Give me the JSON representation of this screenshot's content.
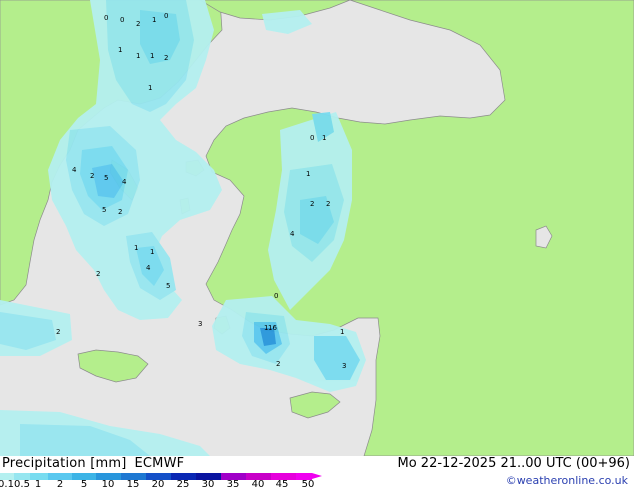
{
  "footer": {
    "title": "Precipitation [mm]",
    "model": "ECMWF",
    "datetime": "Mo 22-12-2025 21..00 UTC (00+96)",
    "credit": "©weatheronline.co.uk"
  },
  "legend": {
    "ticks": [
      "0.1",
      "0.5",
      "1",
      "2",
      "5",
      "10",
      "15",
      "20",
      "25",
      "30",
      "35",
      "40",
      "45",
      "50"
    ],
    "colors": [
      "#b4f0f0",
      "#96e6f0",
      "#78dcf0",
      "#5ac8ef",
      "#3cb4e6",
      "#2896dc",
      "#1e78d2",
      "#1450c8",
      "#0a28b4",
      "#0a14a0",
      "#a000c8",
      "#c800c8",
      "#e600dc",
      "#f000f0"
    ]
  },
  "map_colors": {
    "sea": "#e6e6e6",
    "land": "#b4ee8c",
    "border": "#8c8c8c"
  },
  "precip_labels": [
    {
      "text": "0",
      "lon": 0
    },
    {
      "text": "0",
      "lon": 0
    },
    {
      "text": "2",
      "lon": 0
    },
    {
      "text": "1",
      "lon": 0
    },
    {
      "text": "0",
      "lon": 0
    },
    {
      "text": "1",
      "lon": 0
    },
    {
      "text": "1",
      "lon": 0
    },
    {
      "text": "1",
      "lon": 0
    },
    {
      "text": "2",
      "lon": 0
    },
    {
      "text": "1",
      "lon": 0
    },
    {
      "text": "4",
      "lon": 0
    },
    {
      "text": "2",
      "lon": 0
    },
    {
      "text": "5",
      "lon": 0
    },
    {
      "text": "4",
      "lon": 0
    },
    {
      "text": "5",
      "lon": 0
    },
    {
      "text": "2",
      "lon": 0
    },
    {
      "text": "1",
      "lon": 0
    },
    {
      "text": "4",
      "lon": 0
    },
    {
      "text": "1",
      "lon": 0
    },
    {
      "text": "5",
      "lon": 0
    },
    {
      "text": "2",
      "lon": 0
    },
    {
      "text": "3",
      "lon": 0
    },
    {
      "text": "1",
      "lon": 0
    },
    {
      "text": "2",
      "lon": 0
    },
    {
      "text": "16",
      "lon": 0
    },
    {
      "text": "1",
      "lon": 0
    },
    {
      "text": "4",
      "lon": 0
    },
    {
      "text": "3",
      "lon": 0
    },
    {
      "text": "2",
      "lon": 0
    },
    {
      "text": "2",
      "lon": 0
    },
    {
      "text": "1",
      "lon": 0
    },
    {
      "text": "0",
      "lon": 0
    },
    {
      "text": "0",
      "lon": 0
    },
    {
      "text": "1",
      "lon": 0
    },
    {
      "text": "2",
      "lon": 0
    }
  ]
}
